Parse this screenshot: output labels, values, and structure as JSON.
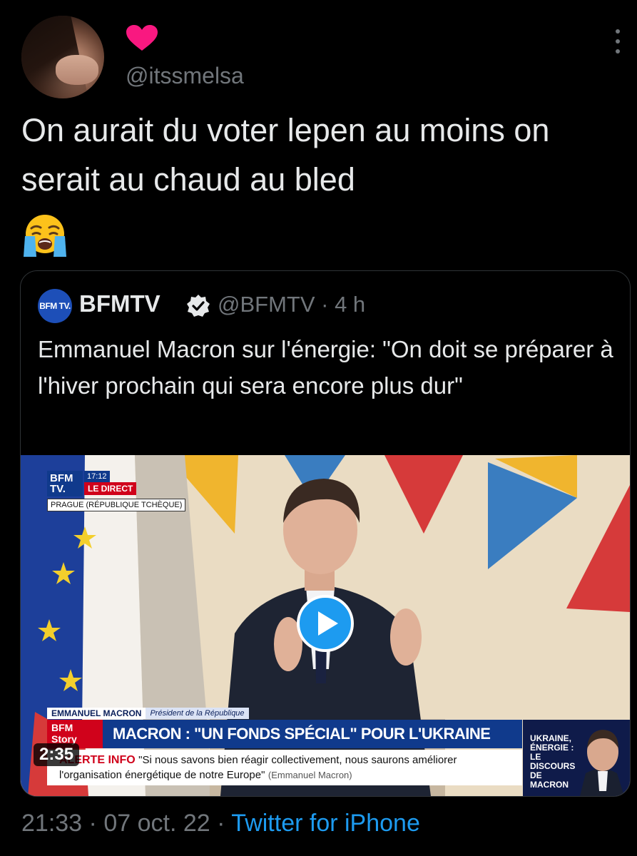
{
  "tweet": {
    "handle": "@itssmelsa",
    "text": "On aurait du voter lepen au moins on serait au chaud au bled",
    "emoji_icon": "loudly-crying-face",
    "icons": [
      "heart-icon",
      "more-vertical-icon"
    ],
    "time": "21:33",
    "date": "07 oct. 22",
    "source": "Twitter for iPhone",
    "separator": "·"
  },
  "quote": {
    "logo": "BFM TV.",
    "name": "BFMTV",
    "handle": "@BFMTV · 4 h",
    "text": "Emmanuel Macron sur l'énergie: \"On doit se préparer à l'hiver prochain qui sera encore plus dur\"",
    "verified_icon": "verified-badge-icon"
  },
  "video": {
    "channel_logo": "BFM TV.",
    "clock": "17:12",
    "live_label": "LE DIRECT",
    "location": "PRAGUE (RÉPUBLIQUE TCHÈQUE)",
    "speaker_name": "EMMANUEL MACRON",
    "speaker_role": "Président de la République",
    "story_logo": "BFM Story",
    "headline": "MACRON : \"UN FONDS SPÉCIAL\" POUR L'UKRAINE",
    "alert_label": "ALERTE INFO",
    "alert_quote": "\"Si nous savons bien réagir collectivement, nous saurons améliorer l'organisation énergétique de notre Europe\"",
    "alert_author": "(Emmanuel Macron)",
    "side_panel": "UKRAINE, ÉNERGIE : LE DISCOURS DE MACRON",
    "duration": "2:35",
    "play_icon": "play-icon"
  },
  "colors": {
    "background": "#000000",
    "text": "#e7e9ea",
    "muted": "#71767b",
    "link": "#1d9bf0",
    "heart": "#f91880",
    "bfm_blue": "#103a8c",
    "bfm_red": "#d0021b"
  }
}
